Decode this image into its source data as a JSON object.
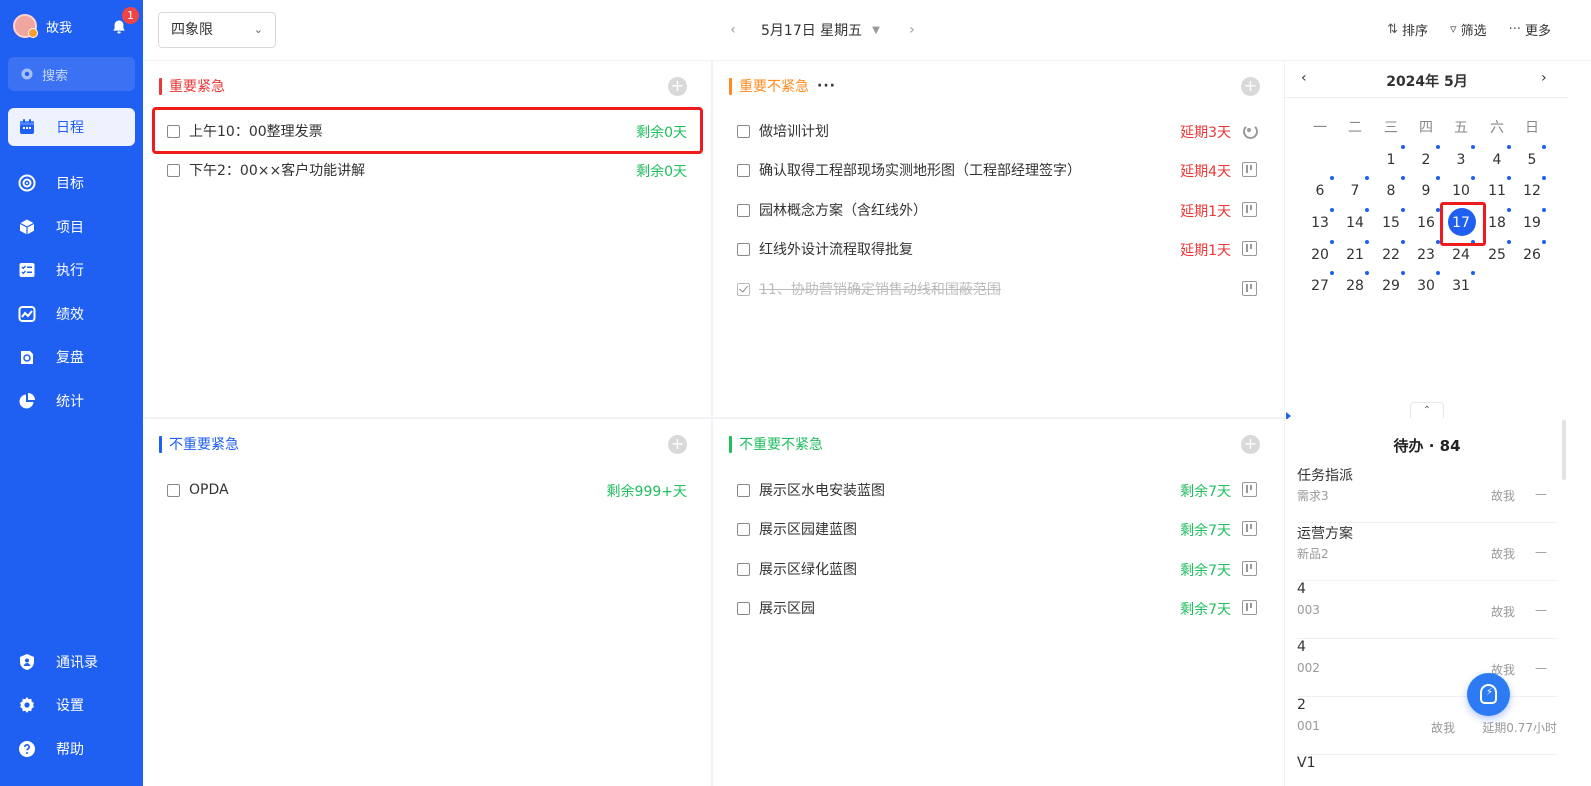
{
  "user": {
    "name": "故我",
    "badge_count": "1"
  },
  "search": {
    "placeholder": "搜索"
  },
  "nav": {
    "items": [
      {
        "label": "日程",
        "icon": "calendar-icon"
      },
      {
        "label": "目标",
        "icon": "target-icon"
      },
      {
        "label": "项目",
        "icon": "cube-icon"
      },
      {
        "label": "执行",
        "icon": "checklist-icon"
      },
      {
        "label": "绩效",
        "icon": "performance-icon"
      },
      {
        "label": "复盘",
        "icon": "review-icon"
      },
      {
        "label": "统计",
        "icon": "pie-chart-icon"
      }
    ],
    "bottom": [
      {
        "label": "通讯录",
        "icon": "contacts-icon"
      },
      {
        "label": "设置",
        "icon": "gear-icon"
      },
      {
        "label": "帮助",
        "icon": "help-icon"
      }
    ]
  },
  "topbar": {
    "view_select": "四象限",
    "date": "5月17日 星期五",
    "tools": {
      "sort": "排序",
      "filter": "筛选",
      "more": "更多"
    }
  },
  "quadrants": {
    "q1": {
      "title": "重要紧急",
      "color": "#ee3636",
      "tasks": [
        {
          "title": "上午10：00整理发票",
          "status": "剩余0天"
        },
        {
          "title": "下午2：00××客户功能讲解",
          "status": "剩余0天"
        }
      ]
    },
    "q2": {
      "title": "重要不紧急",
      "color": "#ff8a1f",
      "tasks": [
        {
          "title": "做培训计划",
          "status": "延期3天"
        },
        {
          "title": "确认取得工程部现场实测地形图（工程部经理签字）",
          "status": "延期4天"
        },
        {
          "title": "园林概念方案（含红线外）",
          "status": "延期1天"
        },
        {
          "title": "红线外设计流程取得批复",
          "status": "延期1天"
        },
        {
          "title": "11、协助营销确定销售动线和围蔽范围",
          "status": ""
        }
      ]
    },
    "q3": {
      "title": "不重要紧急",
      "color": "#1f5ff2",
      "tasks": [
        {
          "title": "OPDA",
          "status": "剩余999+天"
        }
      ]
    },
    "q4": {
      "title": "不重要不紧急",
      "color": "#1fbf5f",
      "tasks": [
        {
          "title": "展示区水电安装蓝图",
          "status": "剩余7天"
        },
        {
          "title": "展示区园建蓝图",
          "status": "剩余7天"
        },
        {
          "title": "展示区绿化蓝图",
          "status": "剩余7天"
        },
        {
          "title": "展示区园",
          "status": "剩余7天"
        }
      ]
    }
  },
  "calendar": {
    "title": "2024年 5月",
    "weekdays": [
      "一",
      "二",
      "三",
      "四",
      "五",
      "六",
      "日"
    ],
    "today": 17
  },
  "todo": {
    "title": "待办 · 84",
    "items": [
      {
        "name": "任务指派",
        "sub": "需求3",
        "owner": "故我",
        "dash": "—"
      },
      {
        "name": "运营方案",
        "sub": "新品2",
        "owner": "故我",
        "dash": "—"
      },
      {
        "name": "4",
        "sub": "003",
        "owner": "故我",
        "dash": "—"
      },
      {
        "name": "4",
        "sub": "002",
        "owner": "故我",
        "dash": "—"
      },
      {
        "name": "2",
        "sub": "001",
        "owner": "故我",
        "delay": "延期0.77小时"
      },
      {
        "name": "V1",
        "sub": "",
        "owner": "",
        "dash": ""
      }
    ]
  }
}
